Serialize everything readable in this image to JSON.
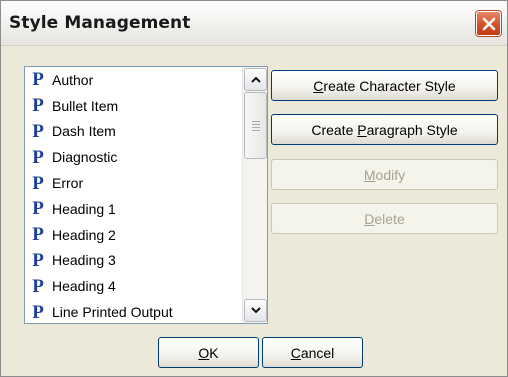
{
  "dialog": {
    "title": "Style Management"
  },
  "style_list": {
    "items": [
      {
        "icon": "P",
        "label": "Author"
      },
      {
        "icon": "P",
        "label": "Bullet Item"
      },
      {
        "icon": "P",
        "label": "Dash Item"
      },
      {
        "icon": "P",
        "label": "Diagnostic"
      },
      {
        "icon": "P",
        "label": "Error"
      },
      {
        "icon": "P",
        "label": "Heading 1"
      },
      {
        "icon": "P",
        "label": "Heading 2"
      },
      {
        "icon": "P",
        "label": "Heading 3"
      },
      {
        "icon": "P",
        "label": "Heading 4"
      },
      {
        "icon": "P",
        "label": "Line Printed Output"
      }
    ]
  },
  "buttons": {
    "create_character_style": {
      "mnemonic": "C",
      "rest": "reate Character Style"
    },
    "create_paragraph_style": {
      "before": "Create ",
      "mnemonic": "P",
      "rest": "aragraph Style"
    },
    "modify": {
      "mnemonic": "M",
      "rest": "odify"
    },
    "delete": {
      "mnemonic": "D",
      "rest": "elete"
    },
    "ok": {
      "mnemonic": "O",
      "rest": "K"
    },
    "cancel": {
      "mnemonic": "C",
      "rest": "ancel"
    }
  },
  "icons": {
    "close": "close-x-icon",
    "style_type": "paragraph-style-icon",
    "scroll_up": "chevron-up-icon",
    "scroll_down": "chevron-down-icon"
  },
  "colors": {
    "close_button": "#d6542d",
    "paragraph_icon": "#1f3f99",
    "button_border": "#003c74",
    "disabled_text": "#a3a292"
  }
}
